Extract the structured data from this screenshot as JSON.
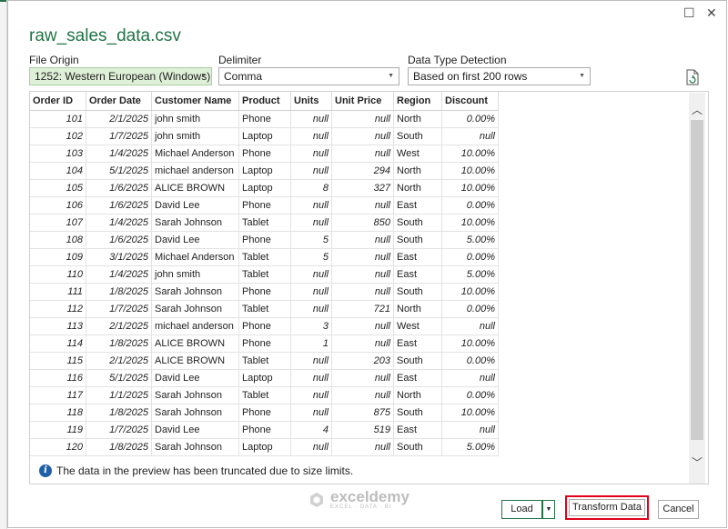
{
  "dialog": {
    "title": "raw_sales_data.csv",
    "file_origin_label": "File Origin",
    "file_origin_value": "1252: Western European (Windows)",
    "delimiter_label": "Delimiter",
    "delimiter_value": "Comma",
    "detection_label": "Data Type Detection",
    "detection_value": "Based on first 200 rows",
    "truncation_note": "The data in the preview has been truncated due to size limits.",
    "info_glyph": "i",
    "buttons": {
      "load": "Load",
      "transform": "Transform Data",
      "cancel": "Cancel"
    },
    "accent_color": "#217346",
    "highlight_color": "#e0001b"
  },
  "window_controls": {
    "maximize": "☐",
    "close": "✕"
  },
  "watermark": {
    "name": "exceldemy",
    "tagline": "EXCEL · DATA · BI"
  },
  "table": {
    "columns": [
      "Order ID",
      "Order Date",
      "Customer Name",
      "Product",
      "Units",
      "Unit Price",
      "Region",
      "Discount"
    ],
    "rows": [
      [
        "101",
        "2/1/2025",
        "john smith",
        "Phone",
        "null",
        "null",
        "North",
        "0.00%"
      ],
      [
        "102",
        "1/7/2025",
        "john smith",
        "Laptop",
        "null",
        "null",
        "South",
        "null"
      ],
      [
        "103",
        "1/4/2025",
        "Michael Anderson",
        "Phone",
        "null",
        "null",
        "West",
        "10.00%"
      ],
      [
        "104",
        "5/1/2025",
        "michael anderson",
        "Laptop",
        "null",
        "294",
        "North",
        "10.00%"
      ],
      [
        "105",
        "1/6/2025",
        "ALICE BROWN",
        "Laptop",
        "8",
        "327",
        "North",
        "10.00%"
      ],
      [
        "106",
        "1/6/2025",
        "David Lee",
        "Phone",
        "null",
        "null",
        "East",
        "0.00%"
      ],
      [
        "107",
        "1/4/2025",
        "Sarah Johnson",
        "Tablet",
        "null",
        "850",
        "South",
        "10.00%"
      ],
      [
        "108",
        "1/6/2025",
        "David Lee",
        "Phone",
        "5",
        "null",
        "South",
        "5.00%"
      ],
      [
        "109",
        "3/1/2025",
        "Michael Anderson",
        "Tablet",
        "5",
        "null",
        "East",
        "0.00%"
      ],
      [
        "110",
        "1/4/2025",
        "john smith",
        "Tablet",
        "null",
        "null",
        "East",
        "5.00%"
      ],
      [
        "111",
        "1/8/2025",
        "Sarah Johnson",
        "Phone",
        "null",
        "null",
        "South",
        "10.00%"
      ],
      [
        "112",
        "1/7/2025",
        "Sarah Johnson",
        "Tablet",
        "null",
        "721",
        "North",
        "0.00%"
      ],
      [
        "113",
        "2/1/2025",
        "michael anderson",
        "Phone",
        "3",
        "null",
        "West",
        "null"
      ],
      [
        "114",
        "1/8/2025",
        "ALICE BROWN",
        "Phone",
        "1",
        "null",
        "East",
        "10.00%"
      ],
      [
        "115",
        "2/1/2025",
        "ALICE BROWN",
        "Tablet",
        "null",
        "203",
        "South",
        "0.00%"
      ],
      [
        "116",
        "5/1/2025",
        "David Lee",
        "Laptop",
        "null",
        "null",
        "East",
        "null"
      ],
      [
        "117",
        "1/1/2025",
        "Sarah Johnson",
        "Tablet",
        "null",
        "null",
        "North",
        "0.00%"
      ],
      [
        "118",
        "1/8/2025",
        "Sarah Johnson",
        "Phone",
        "null",
        "875",
        "South",
        "10.00%"
      ],
      [
        "119",
        "1/7/2025",
        "David Lee",
        "Phone",
        "4",
        "519",
        "East",
        "null"
      ],
      [
        "120",
        "1/8/2025",
        "Sarah Johnson",
        "Laptop",
        "null",
        "null",
        "South",
        "5.00%"
      ]
    ]
  }
}
